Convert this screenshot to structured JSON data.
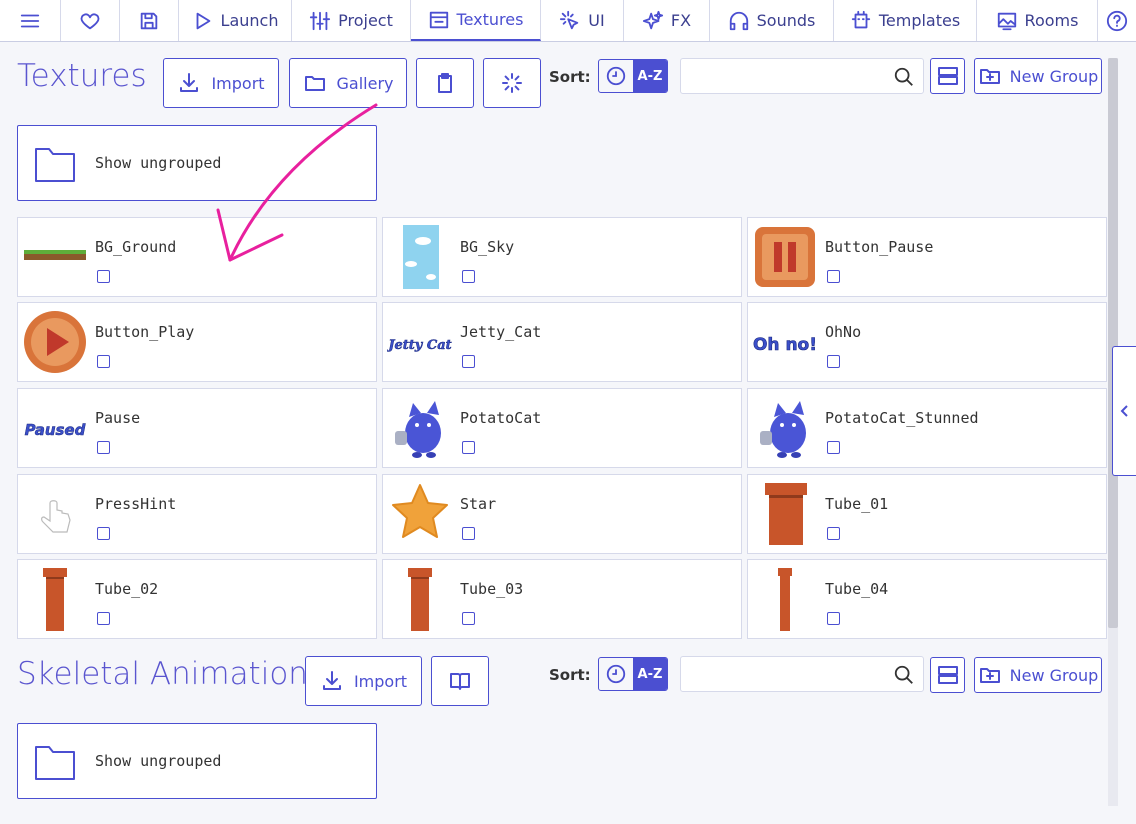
{
  "nav": {
    "tabs": [
      {
        "id": "menu",
        "label": "",
        "icon": "menu-icon"
      },
      {
        "id": "favorites",
        "label": "",
        "icon": "heart-icon"
      },
      {
        "id": "save",
        "label": "",
        "icon": "save-icon"
      },
      {
        "id": "launch",
        "label": "Launch",
        "icon": "play-icon"
      },
      {
        "id": "project",
        "label": "Project",
        "icon": "sliders-icon"
      },
      {
        "id": "textures",
        "label": "Textures",
        "icon": "texture-icon"
      },
      {
        "id": "ui",
        "label": "UI",
        "icon": "cursor-icon"
      },
      {
        "id": "fx",
        "label": "FX",
        "icon": "sparkles-icon"
      },
      {
        "id": "sounds",
        "label": "Sounds",
        "icon": "headphones-icon"
      },
      {
        "id": "templates",
        "label": "Templates",
        "icon": "template-icon"
      },
      {
        "id": "rooms",
        "label": "Rooms",
        "icon": "image-icon"
      },
      {
        "id": "help",
        "label": "",
        "icon": "help-icon"
      }
    ],
    "active": "textures"
  },
  "textures": {
    "title": "Textures",
    "import_label": "Import",
    "gallery_label": "Gallery",
    "sort_label": "Sort:",
    "sort_az_label": "A-Z",
    "search_placeholder": "",
    "new_group_label": "New Group",
    "ungrouped_label": "Show ungrouped",
    "items": [
      {
        "name": "BG_Ground",
        "thumb": "ground"
      },
      {
        "name": "BG_Sky",
        "thumb": "sky"
      },
      {
        "name": "Button_Pause",
        "thumb": "pause-btn"
      },
      {
        "name": "Button_Play",
        "thumb": "play-btn"
      },
      {
        "name": "Jetty_Cat",
        "thumb": "jetty-text"
      },
      {
        "name": "OhNo",
        "thumb": "ohno-text"
      },
      {
        "name": "Pause",
        "thumb": "paused-text"
      },
      {
        "name": "PotatoCat",
        "thumb": "cat"
      },
      {
        "name": "PotatoCat_Stunned",
        "thumb": "cat"
      },
      {
        "name": "PressHint",
        "thumb": "hand"
      },
      {
        "name": "Star",
        "thumb": "star"
      },
      {
        "name": "Tube_01",
        "thumb": "tube-wide"
      },
      {
        "name": "Tube_02",
        "thumb": "tube"
      },
      {
        "name": "Tube_03",
        "thumb": "tube"
      },
      {
        "name": "Tube_04",
        "thumb": "tube-thin"
      }
    ],
    "thumb_text": {
      "jetty": "Jetty Cat",
      "ohno": "Oh no!",
      "paused": "Paused"
    }
  },
  "skeletal": {
    "title": "Skeletal Animation",
    "import_label": "Import",
    "sort_label": "Sort:",
    "sort_az_label": "A-Z",
    "search_placeholder": "",
    "new_group_label": "New Group",
    "ungrouped_label": "Show ungrouped"
  },
  "colors": {
    "accent": "#4b4fd1",
    "annotation": "#e8209e"
  }
}
